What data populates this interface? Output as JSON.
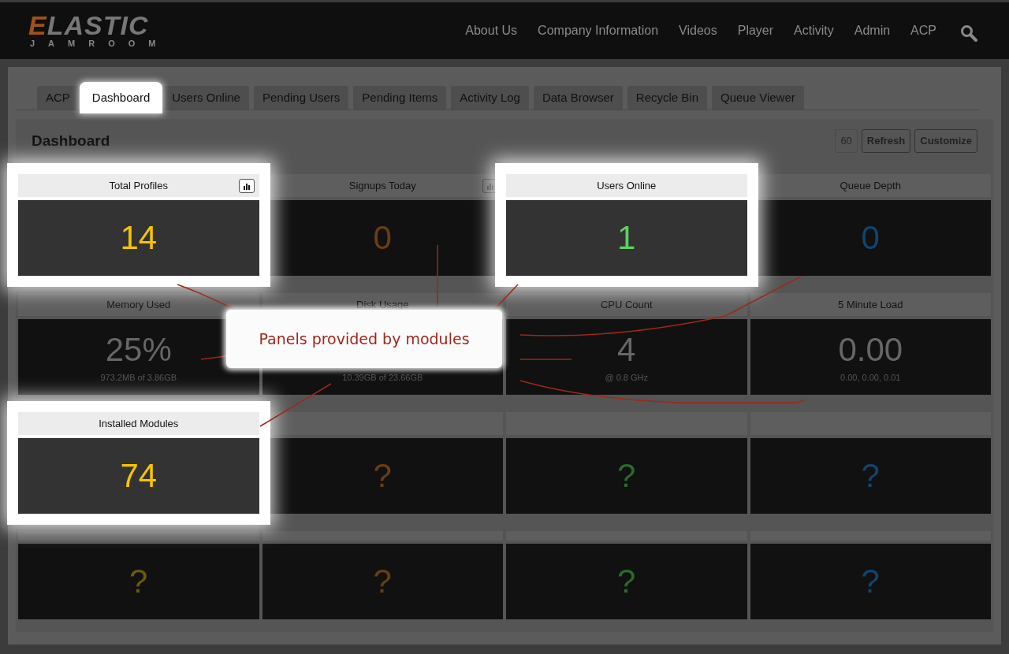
{
  "logo": {
    "word": "ELASTIC",
    "sub": "JAMROOM"
  },
  "nav": [
    "About Us",
    "Company Information",
    "Videos",
    "Player",
    "Activity",
    "Admin",
    "ACP"
  ],
  "tabs": [
    {
      "label": "ACP",
      "selected": false
    },
    {
      "label": "Dashboard",
      "selected": true
    },
    {
      "label": "Users Online",
      "selected": false
    },
    {
      "label": "Pending Users",
      "selected": false
    },
    {
      "label": "Pending Items",
      "selected": false
    },
    {
      "label": "Activity Log",
      "selected": false
    },
    {
      "label": "Data Browser",
      "selected": false
    },
    {
      "label": "Recycle Bin",
      "selected": false
    },
    {
      "label": "Queue Viewer",
      "selected": false
    }
  ],
  "dashboard": {
    "title": "Dashboard",
    "refresh_interval": "60",
    "buttons": [
      "Refresh",
      "Customize"
    ]
  },
  "panels": [
    {
      "title": "Total Profiles",
      "value": "14",
      "color": "#f5c400",
      "highlighted": true,
      "chart_button": true
    },
    {
      "title": "Signups Today",
      "value": "0",
      "color": "#6b3e12",
      "highlighted": false,
      "chart_button": true
    },
    {
      "title": "Users Online",
      "value": "1",
      "color": "#5fcf5f",
      "highlighted": true,
      "chart_button": false
    },
    {
      "title": "Queue Depth",
      "value": "0",
      "color": "#0d4670",
      "highlighted": false,
      "chart_button": false
    },
    {
      "title": "Memory Used",
      "value": "25%",
      "sub": "973.2MB of 3.86GB",
      "color": "#666666",
      "highlighted": false,
      "chart_button": false
    },
    {
      "title": "Disk Usage",
      "sub": "10.39GB of 23.66GB",
      "highlighted": false,
      "chart_button": false
    },
    {
      "title": "CPU Count",
      "value": "4",
      "sub": "@ 0.8 GHz",
      "color": "#666666",
      "highlighted": false,
      "chart_button": false
    },
    {
      "title": "5 Minute Load",
      "value": "0.00",
      "sub": "0.00, 0.00, 0.01",
      "color": "#666666",
      "highlighted": false,
      "chart_button": false
    },
    {
      "title": "Installed Modules",
      "value": "74",
      "color": "#f5c400",
      "highlighted": true,
      "chart_button": false
    },
    {
      "value": "?",
      "color": "#6b3e12",
      "highlighted": false,
      "chart_button": false
    },
    {
      "value": "?",
      "color": "#2a6b2a",
      "highlighted": false,
      "chart_button": false
    },
    {
      "value": "?",
      "color": "#0d4670",
      "highlighted": false,
      "chart_button": false
    },
    {
      "value": "?",
      "color": "#6b5a0a",
      "highlighted": false,
      "chart_button": false
    },
    {
      "value": "?",
      "color": "#6b3e12",
      "highlighted": false,
      "chart_button": false
    },
    {
      "value": "?",
      "color": "#2a6b2a",
      "highlighted": false,
      "chart_button": false
    },
    {
      "value": "?",
      "color": "#0d4670",
      "highlighted": false,
      "chart_button": false
    }
  ],
  "callout": "Panels provided by modules"
}
